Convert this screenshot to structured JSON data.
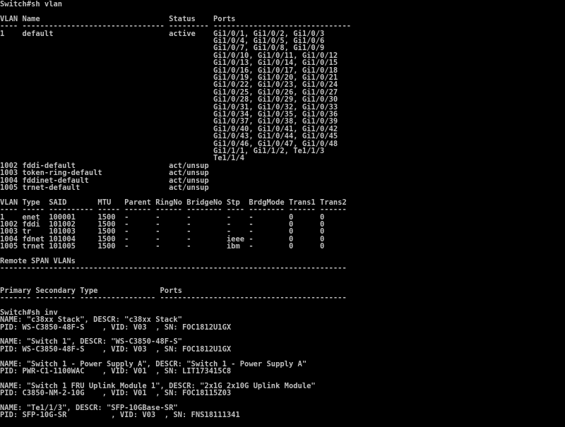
{
  "terminal": {
    "colors": {
      "background": "#000000",
      "foreground": "#c0c0c0"
    },
    "lines": [
      "Switch#sh vlan",
      "",
      "VLAN Name                             Status    Ports",
      "---- -------------------------------- --------- -------------------------------",
      "1    default                          active    Gi1/0/1, Gi1/0/2, Gi1/0/3",
      "                                                Gi1/0/4, Gi1/0/5, Gi1/0/6",
      "                                                Gi1/0/7, Gi1/0/8, Gi1/0/9",
      "                                                Gi1/0/10, Gi1/0/11, Gi1/0/12",
      "                                                Gi1/0/13, Gi1/0/14, Gi1/0/15",
      "                                                Gi1/0/16, Gi1/0/17, Gi1/0/18",
      "                                                Gi1/0/19, Gi1/0/20, Gi1/0/21",
      "                                                Gi1/0/22, Gi1/0/23, Gi1/0/24",
      "                                                Gi1/0/25, Gi1/0/26, Gi1/0/27",
      "                                                Gi1/0/28, Gi1/0/29, Gi1/0/30",
      "                                                Gi1/0/31, Gi1/0/32, Gi1/0/33",
      "                                                Gi1/0/34, Gi1/0/35, Gi1/0/36",
      "                                                Gi1/0/37, Gi1/0/38, Gi1/0/39",
      "                                                Gi1/0/40, Gi1/0/41, Gi1/0/42",
      "                                                Gi1/0/43, Gi1/0/44, Gi1/0/45",
      "                                                Gi1/0/46, Gi1/0/47, Gi1/0/48",
      "                                                Gi1/1/1, Gi1/1/2, Te1/1/3",
      "                                                Te1/1/4",
      "1002 fddi-default                     act/unsup",
      "1003 token-ring-default               act/unsup",
      "1004 fddinet-default                  act/unsup",
      "1005 trnet-default                    act/unsup",
      "",
      "VLAN Type  SAID       MTU   Parent RingNo BridgeNo Stp  BrdgMode Trans1 Trans2",
      "---- ----- ---------- ----- ------ ------ -------- ---- -------- ------ ------",
      "1    enet  100001     1500  -      -      -        -    -        0      0",
      "1002 fddi  101002     1500  -      -      -        -    -        0      0",
      "1003 tr    101003     1500  -      -      -        -    -        0      0",
      "1004 fdnet 101004     1500  -      -      -        ieee -        0      0",
      "1005 trnet 101005     1500  -      -      -        ibm  -        0      0",
      "",
      "Remote SPAN VLANs",
      "------------------------------------------------------------------------------",
      "",
      "",
      "Primary Secondary Type              Ports",
      "------- --------- ----------------- ------------------------------------------",
      "",
      "Switch#sh inv",
      "NAME: \"c38xx Stack\", DESCR: \"c38xx Stack\"",
      "PID: WS-C3850-48F-S    , VID: V03  , SN: FOC1812U1GX",
      "",
      "NAME: \"Switch 1\", DESCR: \"WS-C3850-48F-S\"",
      "PID: WS-C3850-48F-S    , VID: V03  , SN: FOC1812U1GX",
      "",
      "NAME: \"Switch 1 - Power Supply A\", DESCR: \"Switch 1 - Power Supply A\"",
      "PID: PWR-C1-1100WAC    , VID: V01  , SN: LIT173415C8",
      "",
      "NAME: \"Switch 1 FRU Uplink Module 1\", DESCR: \"2x1G 2x10G Uplink Module\"",
      "PID: C3850-NM-2-10G    , VID: V01  , SN: FOC18115Z03",
      "",
      "NAME: \"Te1/1/3\", DESCR: \"SFP-10GBase-SR\"",
      "PID: SFP-10G-SR          , VID: V03  , SN: FNS18111341"
    ]
  }
}
